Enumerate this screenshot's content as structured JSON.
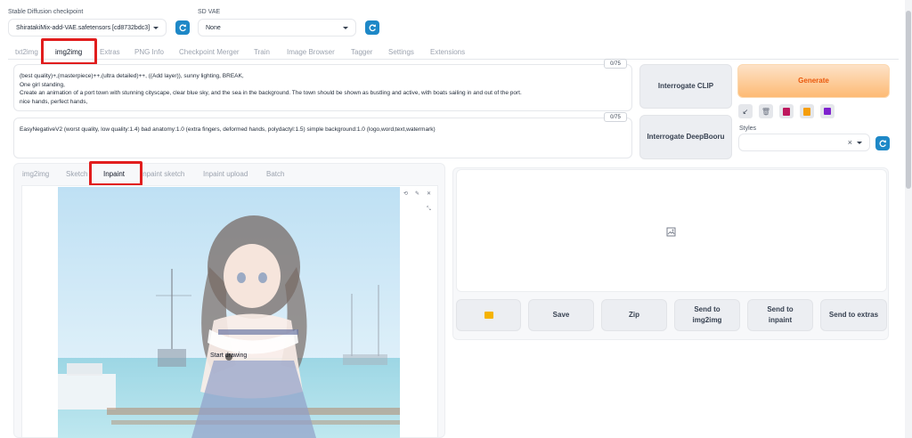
{
  "checkpoint": {
    "label": "Stable Diffusion checkpoint",
    "value": "ShiratakiMix-add-VAE.safetensors [cd8732bdc3]"
  },
  "vae": {
    "label": "SD VAE",
    "value": "None"
  },
  "tabs": [
    "txt2img",
    "img2img",
    "Extras",
    "PNG Info",
    "Checkpoint Merger",
    "Train",
    "Image Browser",
    "Tagger",
    "Settings",
    "Extensions"
  ],
  "prompt": {
    "counter": "0/75",
    "lines": [
      "(best quality)+,(masterpiece)++,(ultra detailed)++, ((Add layer)), sunny lighting, BREAK,",
      "One girl standing,",
      "Create an animation of a port town with stunning cityscape, clear blue sky, and the sea in the background. The town should be shown as bustling and active, with boats sailing in and out of the port.",
      "nice hands, perfect hands,"
    ]
  },
  "negative_prompt": {
    "counter": "0/75",
    "text": "EasyNegativeV2 (worst quality, low quality:1.4) bad anatomy:1.0 (extra fingers, deformed hands, polydactyl:1.5) simple background:1.0 (logo,word,text,watermark)"
  },
  "buttons": {
    "interrogate_clip": "Interrogate CLIP",
    "interrogate_deepbooru": "Interrogate DeepBooru",
    "generate": "Generate"
  },
  "styles": {
    "label": "Styles",
    "clear": "×"
  },
  "subtabs": [
    "img2img",
    "Sketch",
    "Inpaint",
    "Inpaint sketch",
    "Inpaint upload",
    "Batch"
  ],
  "canvas": {
    "overlay_text": "Start drawing"
  },
  "output_buttons": {
    "save": "Save",
    "zip": "Zip",
    "send_img2img": "Send to img2img",
    "send_inpaint": "Send to inpaint",
    "send_extras": "Send to extras"
  },
  "colors": {
    "generate_start": "#fde2c7",
    "generate_end": "#fdba74",
    "accent_red": "#e11d1d",
    "refresh_blue": "#1e88c7"
  }
}
